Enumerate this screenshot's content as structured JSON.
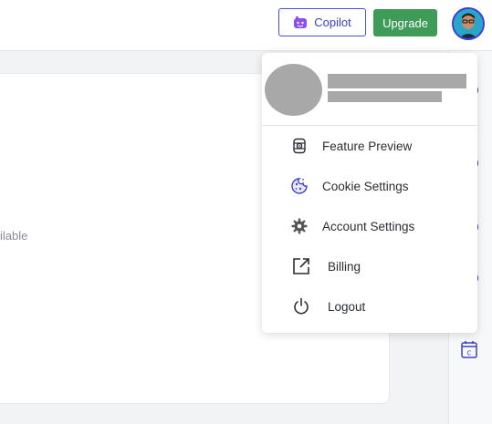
{
  "topbar": {
    "copilot_label": "Copilot",
    "upgrade_label": "Upgrade"
  },
  "content": {
    "partial_text": "ilable"
  },
  "profile_menu": {
    "items": [
      {
        "label": "Feature Preview",
        "icon": "feature-preview-icon"
      },
      {
        "label": "Cookie Settings",
        "icon": "cookie-icon"
      },
      {
        "label": "Account Settings",
        "icon": "gear-icon"
      },
      {
        "label": "Billing",
        "icon": "external-link-icon"
      },
      {
        "label": "Logout",
        "icon": "power-icon"
      }
    ]
  },
  "colors": {
    "accent": "#3d41c9",
    "upgrade": "#3f9b58",
    "redaction": "#a8a8a8"
  }
}
